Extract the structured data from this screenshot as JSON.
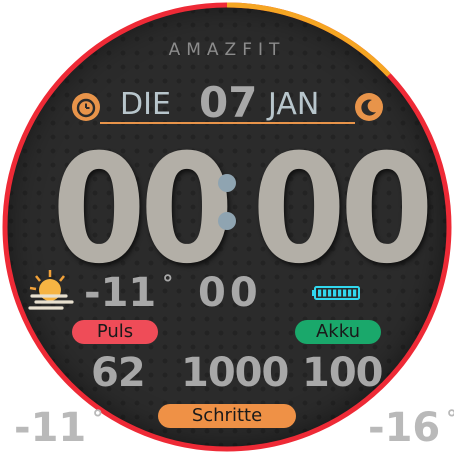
{
  "brand": "AMAZFIT",
  "date": {
    "day": "DIE",
    "num": "07",
    "month": "JAN"
  },
  "time": {
    "hours": "00",
    "minutes": "00"
  },
  "weather": {
    "temp": "-11",
    "deg": "°"
  },
  "middle_value": "00",
  "labels": {
    "puls": "Puls",
    "akku": "Akku",
    "schritte": "Schritte"
  },
  "values": {
    "puls": "62",
    "schritte": "1000",
    "akku": "100"
  },
  "temps": {
    "low": "-11",
    "high": "-16",
    "deg": "°"
  },
  "battery_level": 1.0,
  "progress_fraction": 0.13,
  "icons": {
    "alarm": "alarm-clock-icon",
    "moon": "moon-icon",
    "weather": "partly-cloudy-icon",
    "battery": "battery-icon"
  },
  "colors": {
    "accent_orange": "#e8944a",
    "ring_red": "#ee2a36",
    "puls_red": "#ef4c58",
    "akku_green": "#1aa86b",
    "battery_cyan": "#31d8ef"
  }
}
